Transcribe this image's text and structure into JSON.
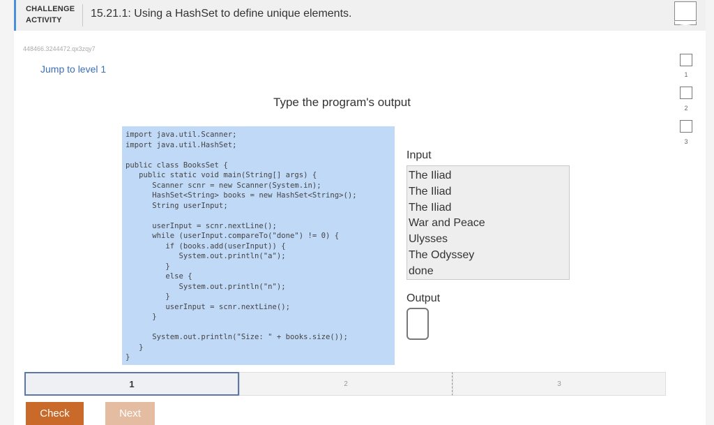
{
  "header": {
    "label_line1": "CHALLENGE",
    "label_line2": "ACTIVITY",
    "title": "15.21.1: Using a HashSet to define unique elements."
  },
  "activity_id": "448466.3244472.qx3zqy7",
  "jump_link": "Jump to level 1",
  "prompt": "Type the program's output",
  "code_lines": [
    "import java.util.Scanner;",
    "import java.util.HashSet;",
    "",
    "public class BooksSet {",
    "   public static void main(String[] args) {",
    "      Scanner scnr = new Scanner(System.in);",
    "      HashSet<String> books = new HashSet<String>();",
    "      String userInput;",
    "",
    "      userInput = scnr.nextLine();",
    "      while (userInput.compareTo(\"done\") != 0) {",
    "         if (books.add(userInput)) {",
    "            System.out.println(\"a\");",
    "         }",
    "         else {",
    "            System.out.println(\"n\");",
    "         }",
    "         userInput = scnr.nextLine();",
    "      }",
    "",
    "      System.out.println(\"Size: \" + books.size());",
    "   }",
    "}"
  ],
  "input": {
    "label": "Input",
    "lines": [
      "The Iliad",
      "The Iliad",
      "The Iliad",
      "War and Peace",
      "Ulysses",
      "The Odyssey",
      "done"
    ]
  },
  "output": {
    "label": "Output",
    "value": ""
  },
  "levels": [
    "1",
    "2",
    "3"
  ],
  "buttons": {
    "check": "Check",
    "next": "Next"
  },
  "side_levels": [
    "1",
    "2",
    "3"
  ],
  "colors": {
    "accent": "#4a90d9",
    "code_bg": "#bfd9f7",
    "check_button": "#c9692a",
    "next_button": "#e4bca1",
    "link": "#3b6fb6"
  },
  "icons": {
    "progress_flag": "completion-flag-icon"
  }
}
